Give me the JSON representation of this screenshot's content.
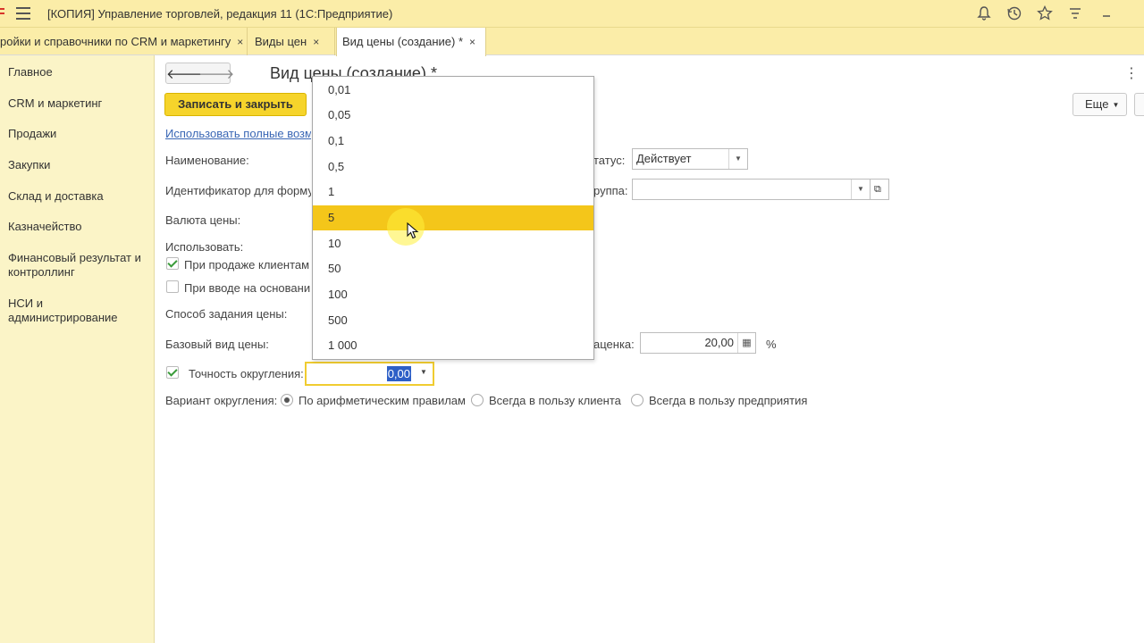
{
  "window": {
    "title": "[КОПИЯ] Управление торговлей, редакция 11  (1С:Предприятие)"
  },
  "titlebar_icons": [
    "bell-icon",
    "history-icon",
    "star-icon",
    "filter-icon",
    "minimize-icon"
  ],
  "tabs": [
    {
      "label": "ройки и справочники по CRM и маркетингу",
      "close": "×"
    },
    {
      "label": "Виды цен",
      "close": "×"
    },
    {
      "label": "Вид цены (создание) *",
      "close": "×"
    }
  ],
  "sidebar": {
    "items": [
      {
        "label": "Главное"
      },
      {
        "label": "CRM и маркетинг"
      },
      {
        "label": "Продажи"
      },
      {
        "label": "Закупки"
      },
      {
        "label": "Склад и доставка"
      },
      {
        "label": "Казначейство"
      },
      {
        "label": "Финансовый результат и контроллинг"
      },
      {
        "label": "НСИ и администрирование"
      }
    ]
  },
  "form": {
    "title": "Вид цены (создание) *",
    "save_label": "Записать и закрыть",
    "more_label": "Еще",
    "link_label": "Использовать полные возм",
    "name_label": "Наименование:",
    "id_label": "Идентификатор для форму",
    "currency_label": "Валюта цены:",
    "use_label": "Использовать:",
    "use_sales_label": "При продаже клиентам",
    "use_input_label": "При вводе на основани",
    "method_label": "Способ задания цены:",
    "base_label": "Базовый вид цены:",
    "rounding_label": "Точность округления:",
    "rounding_value": "0,00",
    "status_label": "татус:",
    "status_value": "Действует",
    "group_label": "руппа:",
    "group_value": "",
    "markup_label": "аценка:",
    "markup_value": "20,00",
    "percent_label": "%",
    "variant_label": "Вариант округления:",
    "variant_options": [
      {
        "label": "По арифметическим правилам",
        "selected": true
      },
      {
        "label": "Всегда в пользу клиента",
        "selected": false
      },
      {
        "label": "Всегда в пользу предприятия",
        "selected": false
      }
    ]
  },
  "dropdown": {
    "options": [
      "0,01",
      "0,05",
      "0,1",
      "0,5",
      "1",
      "5",
      "10",
      "50",
      "100",
      "500",
      "1 000"
    ],
    "selected": "5"
  },
  "colors": {
    "accent": "#f6d42b",
    "selected_row": "#f4c61a",
    "titlebar": "#fbeda8",
    "sidebar": "#fbf4c7",
    "link": "#3a67b5"
  }
}
